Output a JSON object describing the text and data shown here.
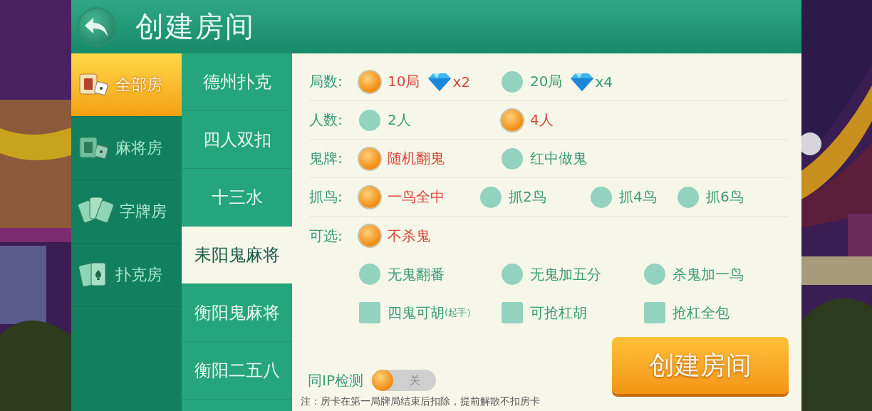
{
  "header": {
    "title": "创建房间"
  },
  "categories": [
    {
      "label": "全部房",
      "kind": "tile",
      "selected": true
    },
    {
      "label": "麻将房",
      "kind": "tile",
      "selected": false
    },
    {
      "label": "字牌房",
      "kind": "cards",
      "selected": false
    },
    {
      "label": "扑克房",
      "kind": "poker",
      "selected": false
    }
  ],
  "games": [
    {
      "label": "德州扑克",
      "selected": false
    },
    {
      "label": "四人双扣",
      "selected": false
    },
    {
      "label": "十三水",
      "selected": false
    },
    {
      "label": "耒阳鬼麻将",
      "selected": true
    },
    {
      "label": "衡阳鬼麻将",
      "selected": false
    },
    {
      "label": "衡阳二五八",
      "selected": false
    }
  ],
  "option_rows": [
    {
      "label": "局数:",
      "options": [
        {
          "kind": "radio",
          "text": "10局",
          "cost": "x2",
          "selected": true
        },
        {
          "kind": "radio",
          "text": "20局",
          "cost": "x4",
          "selected": false
        }
      ]
    },
    {
      "label": "人数:",
      "options": [
        {
          "kind": "radio",
          "text": "2人",
          "selected": false
        },
        {
          "kind": "radio",
          "text": "4人",
          "selected": true
        }
      ]
    },
    {
      "label": "鬼牌:",
      "options": [
        {
          "kind": "radio",
          "text": "随机翻鬼",
          "selected": true
        },
        {
          "kind": "radio",
          "text": "红中做鬼",
          "selected": false
        }
      ]
    },
    {
      "label": "抓鸟:",
      "options": [
        {
          "kind": "radio",
          "text": "一鸟全中",
          "selected": true
        },
        {
          "kind": "radio",
          "text": "抓2鸟",
          "selected": false
        },
        {
          "kind": "radio",
          "text": "抓4鸟",
          "selected": false
        },
        {
          "kind": "radio",
          "text": "抓6鸟",
          "selected": false
        }
      ]
    },
    {
      "label": "可选:",
      "options": [
        {
          "kind": "radio",
          "text": "不杀鬼",
          "selected": true
        }
      ]
    },
    {
      "options": [
        {
          "kind": "radio",
          "text": "无鬼翻番",
          "selected": false
        },
        {
          "kind": "radio",
          "text": "无鬼加五分",
          "selected": false
        },
        {
          "kind": "radio",
          "text": "杀鬼加一鸟",
          "selected": false
        }
      ]
    },
    {
      "options": [
        {
          "kind": "checkbox",
          "text": "四鬼可胡",
          "note": "(起手）",
          "checked": false
        },
        {
          "kind": "checkbox",
          "text": "可抢杠胡",
          "checked": false
        },
        {
          "kind": "checkbox",
          "text": "抢杠全包",
          "checked": false
        }
      ]
    }
  ],
  "ip_check": {
    "label": "同IP检测",
    "on": false,
    "state_text": "关"
  },
  "create_button": "创建房间",
  "note": "注：房卡在第一局牌局结束后扣除，提前解散不扣房卡"
}
